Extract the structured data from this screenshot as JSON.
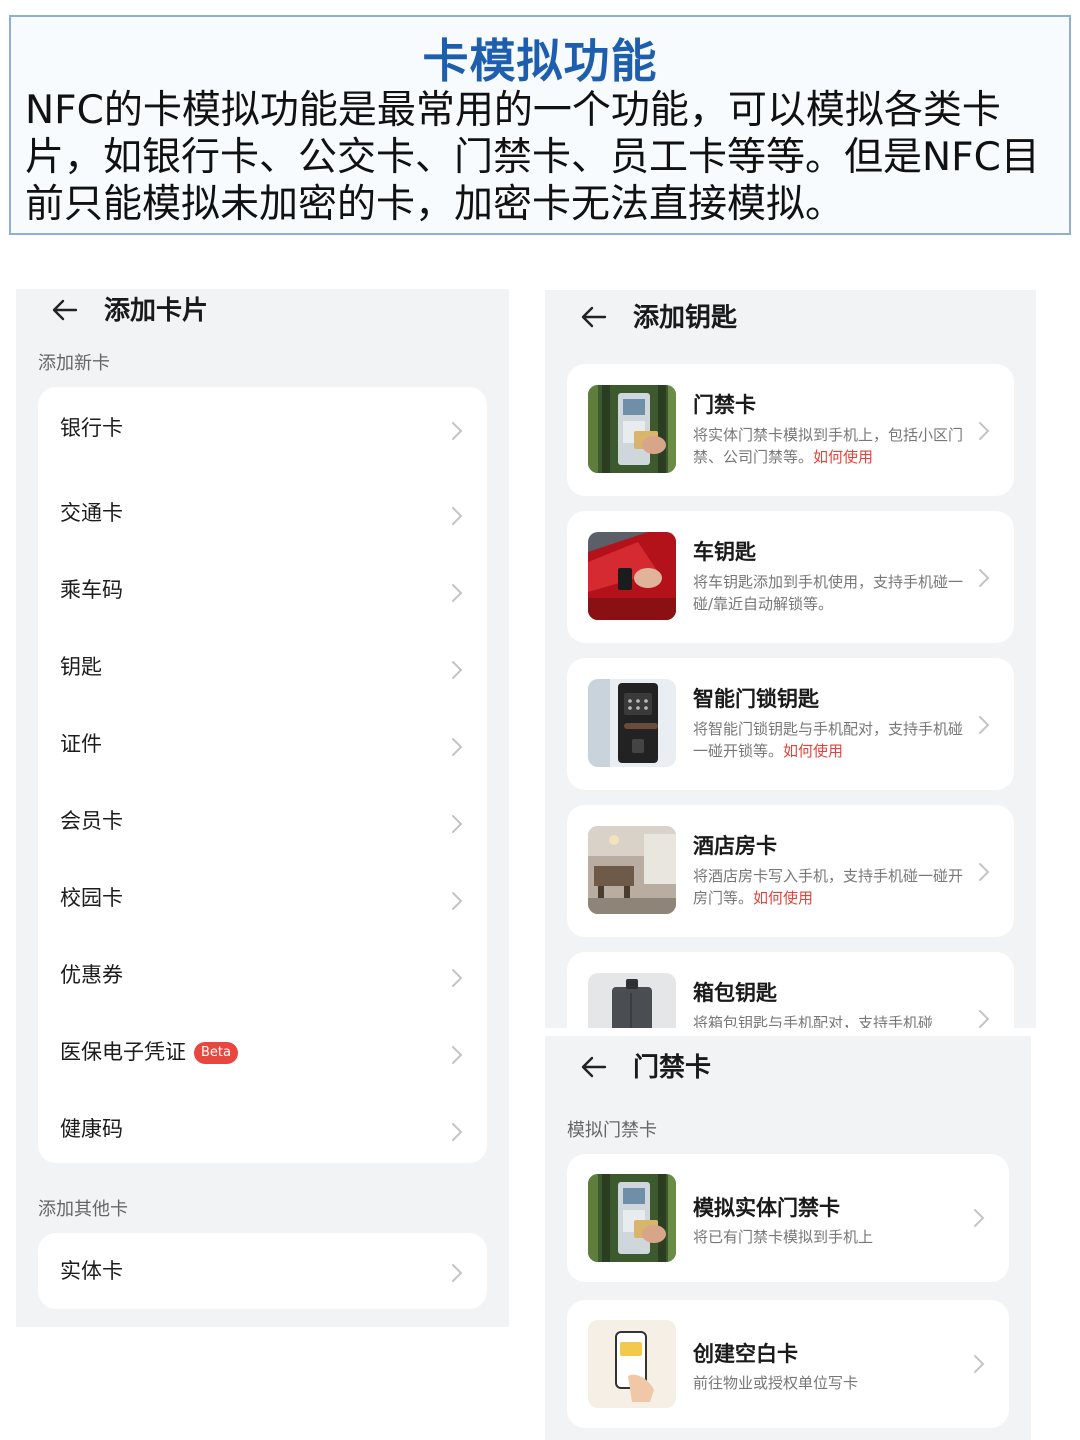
{
  "header": {
    "title": "卡模拟功能",
    "body": "NFC的卡模拟功能是最常用的一个功能，可以模拟各类卡片，如银行卡、公交卡、门禁卡、员工卡等等。但是NFC目前只能模拟未加密的卡，加密卡无法直接模拟。"
  },
  "add_card": {
    "title": "添加卡片",
    "section_new": "添加新卡",
    "items": [
      {
        "label": "银行卡"
      },
      {
        "label": "交通卡"
      },
      {
        "label": "乘车码"
      },
      {
        "label": "钥匙"
      },
      {
        "label": "证件"
      },
      {
        "label": "会员卡"
      },
      {
        "label": "校园卡"
      },
      {
        "label": "优惠券"
      },
      {
        "label": "医保电子凭证",
        "badge": "Beta"
      },
      {
        "label": "健康码"
      }
    ],
    "section_other": "添加其他卡",
    "other_items": [
      {
        "label": "实体卡"
      }
    ]
  },
  "add_key": {
    "title": "添加钥匙",
    "items": [
      {
        "title": "门禁卡",
        "desc": "将实体门禁卡模拟到手机上，包括小区门禁、公司门禁等。",
        "link": "如何使用",
        "icon": "door-access-photo"
      },
      {
        "title": "车钥匙",
        "desc": "将车钥匙添加到手机使用，支持手机碰一碰/靠近自动解锁等。",
        "link": "",
        "icon": "car-door-photo"
      },
      {
        "title": "智能门锁钥匙",
        "desc": "将智能门锁钥匙与手机配对，支持手机碰一碰开锁等。",
        "link": "如何使用",
        "icon": "smart-lock-photo"
      },
      {
        "title": "酒店房卡",
        "desc": "将酒店房卡写入手机，支持手机碰一碰开房门等。",
        "link": "如何使用",
        "icon": "hotel-room-photo"
      },
      {
        "title": "箱包钥匙",
        "desc": "将箱包钥匙与手机配对，支持手机碰",
        "link": "",
        "icon": "luggage-photo"
      }
    ]
  },
  "door_card": {
    "title": "门禁卡",
    "section": "模拟门禁卡",
    "items": [
      {
        "title": "模拟实体门禁卡",
        "desc": "将已有门禁卡模拟到手机上",
        "icon": "door-access-photo"
      },
      {
        "title": "创建空白卡",
        "desc": "前往物业或授权单位写卡",
        "icon": "phone-card-icon"
      }
    ]
  },
  "colors": {
    "title_blue": "#1d5fae",
    "link_red": "#e0453d",
    "beta_red": "#e8473f",
    "panel_bg": "#f1f3f5",
    "card_bg": "#ffffff"
  }
}
